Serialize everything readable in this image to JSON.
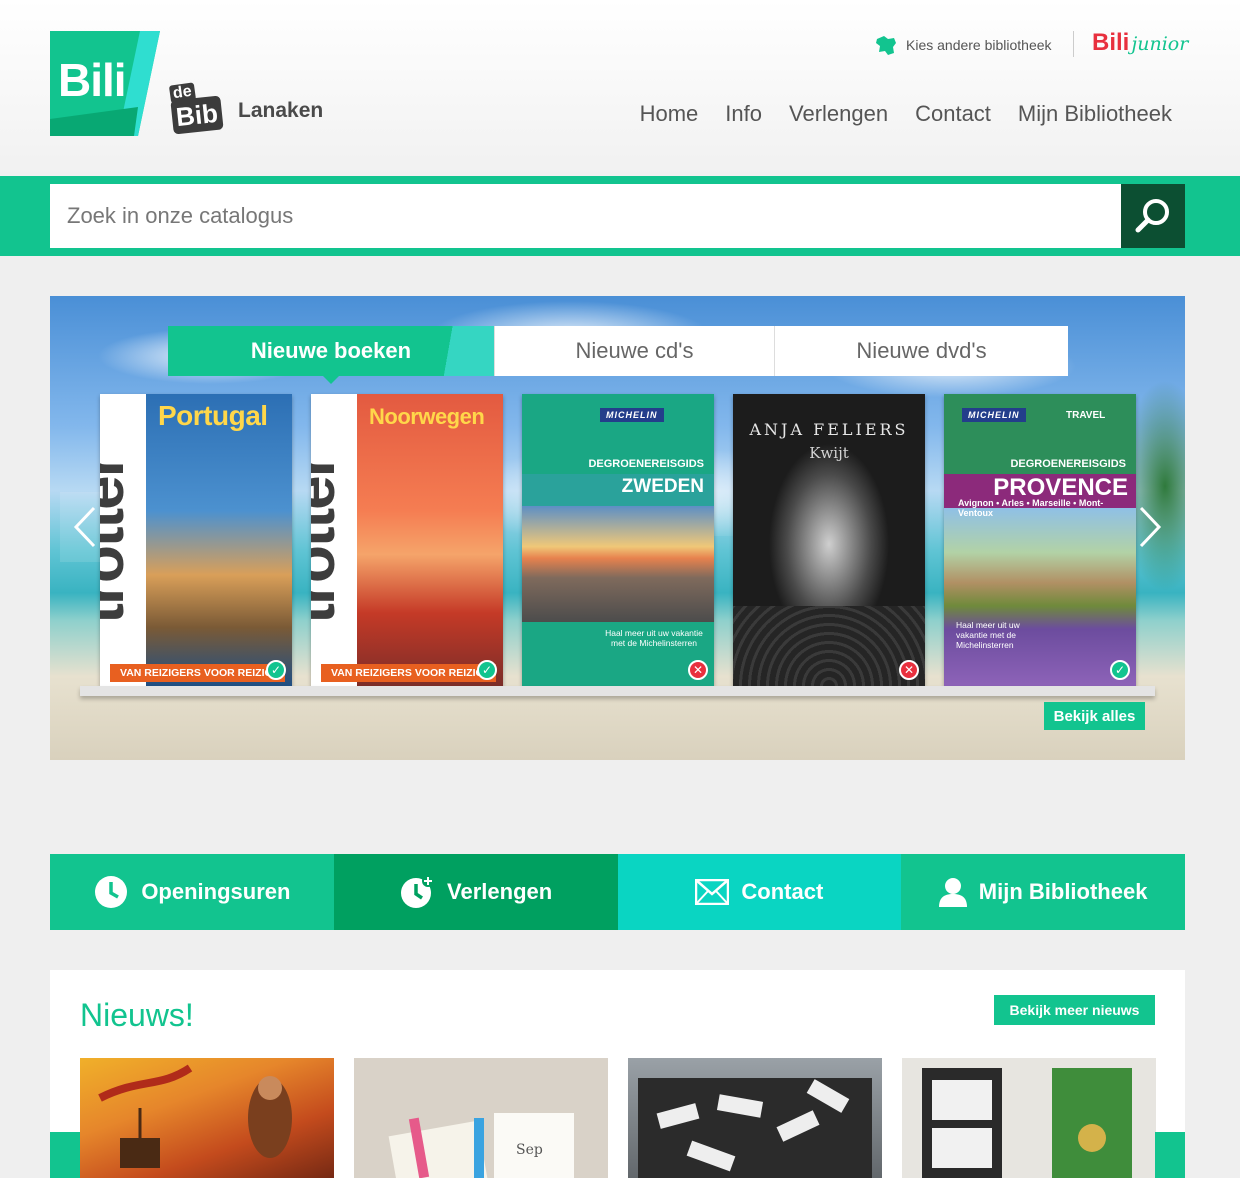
{
  "header": {
    "logo_text": "Bili",
    "debib_de": "de",
    "debib_bib": "Bib",
    "library_name": "Lanaken",
    "switch_library": "Kies andere bibliotheek",
    "junior_bili": "Bili",
    "junior_text": "junior",
    "nav": [
      "Home",
      "Info",
      "Verlengen",
      "Contact",
      "Mijn Bibliotheek"
    ]
  },
  "search": {
    "placeholder": "Zoek in onze catalogus"
  },
  "carousel": {
    "tabs": [
      "Nieuwe boeken",
      "Nieuwe cd's",
      "Nieuwe dvd's"
    ],
    "active_tab": 0,
    "books": [
      {
        "title": "Portugal",
        "series": "trotter",
        "strip": "VAN REIZIGERS VOOR REIZIGERS",
        "available": true
      },
      {
        "title": "Noorwegen",
        "series": "trotter",
        "strip": "VAN REIZIGERS VOOR REIZIGERS",
        "available": true
      },
      {
        "brand": "MICHELIN",
        "series": "DEGROENEREISGIDS",
        "title": "ZWEDEN",
        "note": "Haal meer uit uw vakantie met de Michelinsterren",
        "available": false
      },
      {
        "author": "ANJA FELIERS",
        "title": "Kwijt",
        "available": false
      },
      {
        "brand": "MICHELIN",
        "brand_extra": "TRAVEL",
        "series": "DEGROENEREISGIDS",
        "title": "PROVENCE",
        "subtitle": "Avignon • Arles • Marseille • Mont-Ventoux",
        "note": "Haal meer uit uw vakantie met de Michelinsterren",
        "available": true
      }
    ],
    "see_all": "Bekijk alles"
  },
  "quicklinks": [
    {
      "label": "Openingsuren",
      "icon": "clock-icon"
    },
    {
      "label": "Verlengen",
      "icon": "clock-plus-icon"
    },
    {
      "label": "Contact",
      "icon": "envelope-icon"
    },
    {
      "label": "Mijn Bibliotheek",
      "icon": "user-icon"
    }
  ],
  "news": {
    "title": "Nieuws!",
    "more": "Bekijk meer nieuws"
  },
  "colors": {
    "brand_green": "#12c48f",
    "dark_green": "#0c4f32",
    "teal": "#0ad5c2",
    "junior_red": "#e8303e"
  }
}
